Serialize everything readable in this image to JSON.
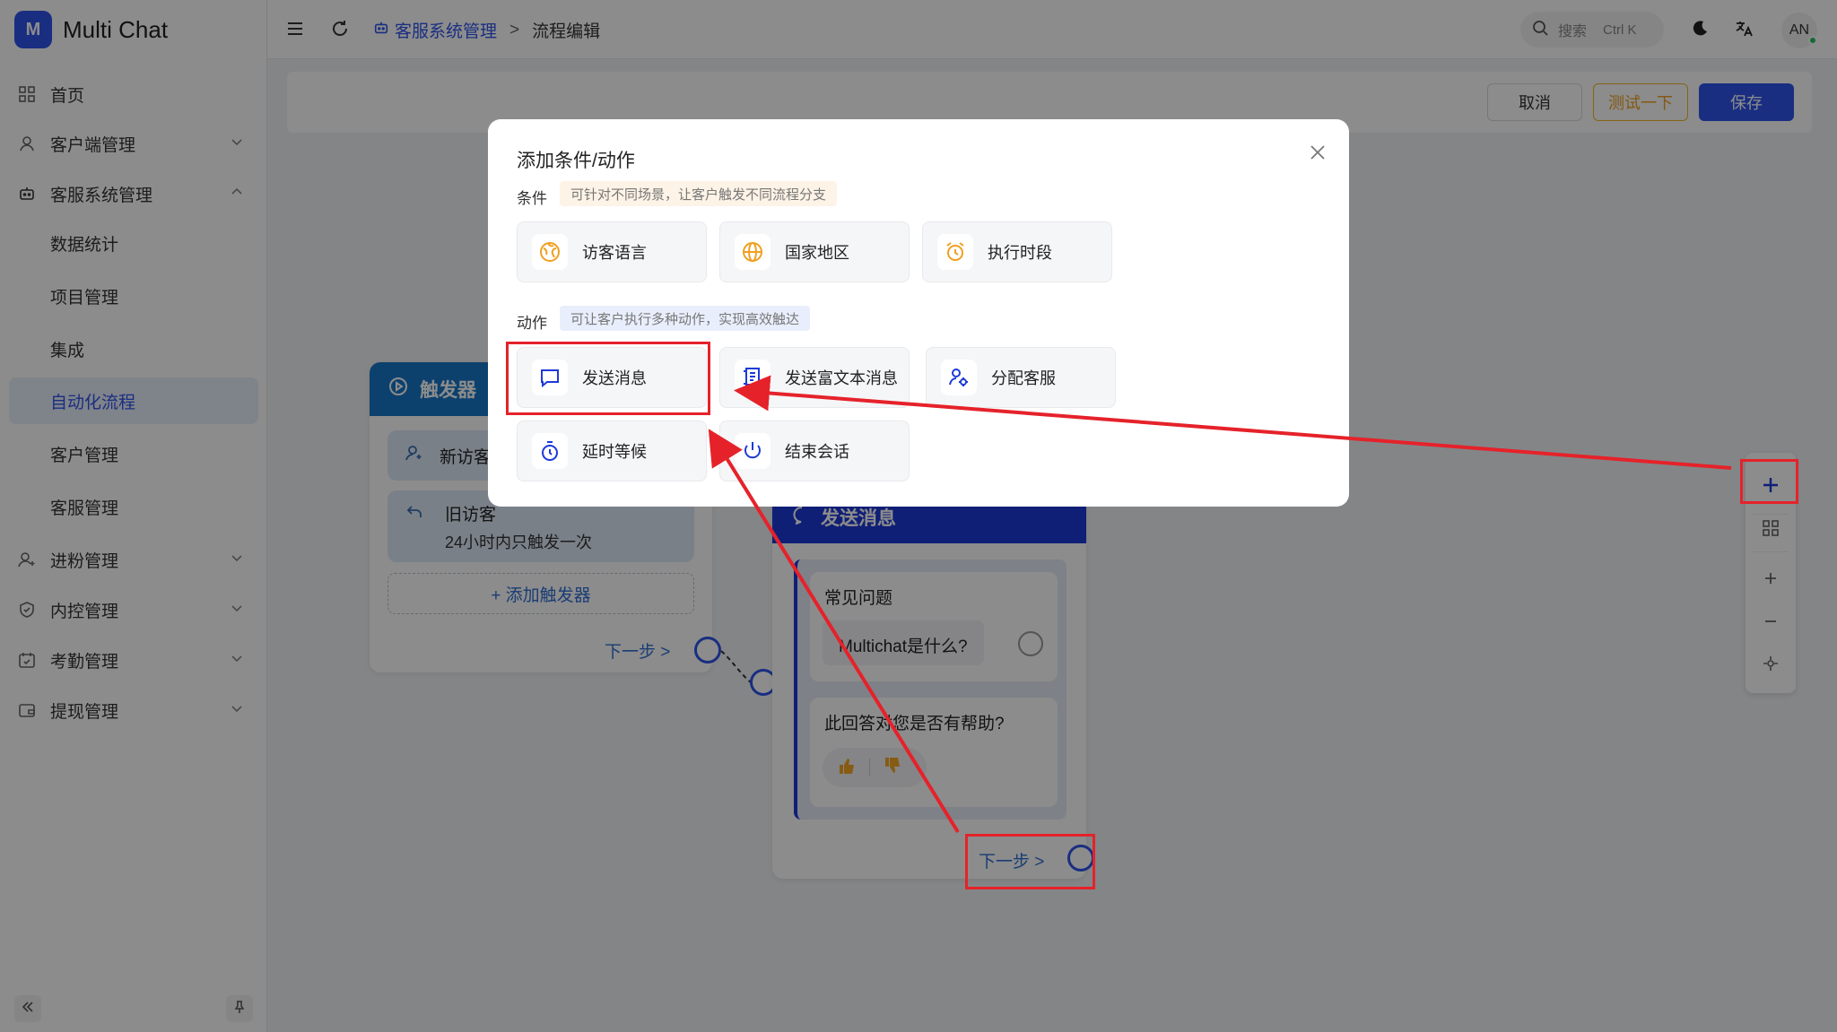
{
  "app": {
    "name": "Multi Chat",
    "logo_letter": "M"
  },
  "sidebar": {
    "items": [
      {
        "label": "首页"
      },
      {
        "label": "客户端管理"
      },
      {
        "label": "客服系统管理"
      },
      {
        "label": "进粉管理"
      },
      {
        "label": "内控管理"
      },
      {
        "label": "考勤管理"
      },
      {
        "label": "提现管理"
      }
    ],
    "sub_items": [
      {
        "label": "数据统计"
      },
      {
        "label": "项目管理"
      },
      {
        "label": "集成"
      },
      {
        "label": "自动化流程"
      },
      {
        "label": "客户管理"
      },
      {
        "label": "客服管理"
      }
    ],
    "active_sub": "自动化流程"
  },
  "header": {
    "breadcrumb_parent": "客服系统管理",
    "breadcrumb_sep": ">",
    "breadcrumb_current": "流程编辑",
    "search_placeholder": "搜索",
    "search_shortcut": "Ctrl K",
    "avatar_initials": "AN"
  },
  "toolbar": {
    "cancel_label": "取消",
    "test_label": "测试一下",
    "save_label": "保存"
  },
  "canvas": {
    "trigger_card": {
      "title": "触发器",
      "new_visitor": "新访客",
      "old_visitor": "旧访客",
      "old_visitor_desc": "24小时内只触发一次",
      "add_trigger": "+ 添加触发器",
      "next_step": "下一步 >"
    },
    "message_card": {
      "title": "发送消息",
      "faq_title": "常见问题",
      "faq_question": "Multichat是什么?",
      "helpful_question": "此回答对您是否有帮助?",
      "next_step": "下一步 >"
    }
  },
  "modal": {
    "title": "添加条件/动作",
    "conditions_label": "条件",
    "conditions_hint": "可针对不同场景，让客户触发不同流程分支",
    "conditions": [
      {
        "label": "访客语言",
        "icon": "language-icon"
      },
      {
        "label": "国家地区",
        "icon": "globe-icon"
      },
      {
        "label": "执行时段",
        "icon": "alarm-clock-icon"
      }
    ],
    "actions_label": "动作",
    "actions_hint": "可让客户执行多种动作，实现高效触达",
    "actions": [
      {
        "label": "发送消息",
        "icon": "message-icon"
      },
      {
        "label": "发送富文本消息",
        "icon": "rich-text-icon"
      },
      {
        "label": "分配客服",
        "icon": "assign-agent-icon"
      },
      {
        "label": "延时等候",
        "icon": "timer-icon"
      },
      {
        "label": "结束会话",
        "icon": "power-icon"
      }
    ]
  },
  "colors": {
    "primary": "#2f54eb",
    "annotation": "#e5222a",
    "trigger_header": "#1677c8",
    "message_header": "#1d3ad8"
  }
}
